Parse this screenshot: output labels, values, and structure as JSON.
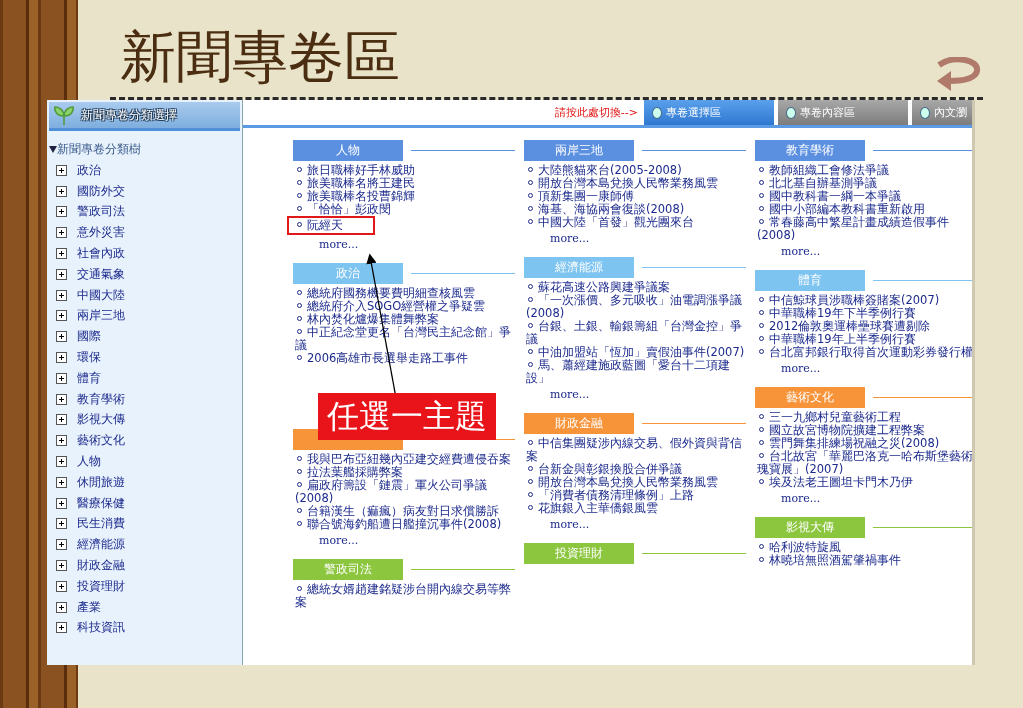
{
  "slide": {
    "title": "新聞專卷區"
  },
  "sidebar": {
    "header": "新聞專卷分類選擇",
    "tree": {
      "label": "新聞專卷分類樹",
      "expanded": true,
      "children": [
        {
          "label": "政治",
          "expanded": false
        },
        {
          "label": "國防外交",
          "expanded": false
        },
        {
          "label": "警政司法",
          "expanded": false
        },
        {
          "label": "意外災害",
          "expanded": false
        },
        {
          "label": "社會內政",
          "expanded": false
        },
        {
          "label": "交通氣象",
          "expanded": false
        },
        {
          "label": "中國大陸",
          "expanded": false
        },
        {
          "label": "兩岸三地",
          "expanded": false
        },
        {
          "label": "國際",
          "expanded": false
        },
        {
          "label": "環保",
          "expanded": false
        },
        {
          "label": "體育",
          "expanded": false
        },
        {
          "label": "教育學術",
          "expanded": false
        },
        {
          "label": "影視大傳",
          "expanded": false
        },
        {
          "label": "藝術文化",
          "expanded": false
        },
        {
          "label": "人物",
          "expanded": false
        },
        {
          "label": "休閒旅遊",
          "expanded": false
        },
        {
          "label": "醫療保健",
          "expanded": false
        },
        {
          "label": "民生消費",
          "expanded": false
        },
        {
          "label": "經濟能源",
          "expanded": false
        },
        {
          "label": "財政金融",
          "expanded": false
        },
        {
          "label": "投資理財",
          "expanded": false
        },
        {
          "label": "產業",
          "expanded": false
        },
        {
          "label": "科技資訊",
          "expanded": false
        }
      ]
    }
  },
  "toolbar": {
    "hint": "請按此處切換-->",
    "tabs": [
      {
        "label": "專卷選擇區",
        "selected": true
      },
      {
        "label": "專卷內容區",
        "selected": false
      },
      {
        "label": "內文瀏",
        "selected": false
      }
    ]
  },
  "columns": [
    {
      "sections": [
        {
          "title": "人物",
          "color": "#5b8fe0",
          "items": [
            {
              "text": "旅日職棒好手林威助",
              "highlighted": false
            },
            {
              "text": "旅美職棒名將王建民",
              "highlighted": false
            },
            {
              "text": "旅美職棒名投曹錦輝",
              "highlighted": false
            },
            {
              "text": "「恰恰」彭政閔",
              "highlighted": false
            },
            {
              "text": "阮經天",
              "highlighted": true
            }
          ],
          "more": "more..."
        },
        {
          "title": "政治",
          "color": "#7ec4f0",
          "items": [
            {
              "text": "總統府國務機要費明細查核風雲",
              "highlighted": false
            },
            {
              "text": "總統府介入SOGO經營權之爭疑雲",
              "highlighted": false
            },
            {
              "text": "林內焚化爐爆集體舞弊案",
              "highlighted": false
            },
            {
              "text": "中正紀念堂更名「台灣民主紀念館」爭議",
              "highlighted": false
            },
            {
              "text": "2006高雄市長選舉走路工事件",
              "highlighted": false
            }
          ]
        },
        {
          "color": "#f7943a",
          "items": [
            {
              "text": "我與巴布亞紐幾內亞建交經費遭侵吞案",
              "highlighted": false
            },
            {
              "text": "拉法葉艦採購弊案",
              "highlighted": false
            },
            {
              "text": "扁政府籌設「鏈震」軍火公司爭議(2008)",
              "highlighted": false
            },
            {
              "text": "台籍漢生（痲瘋）病友對日求償勝訴",
              "highlighted": false
            },
            {
              "text": "聯合號海釣船遭日艦撞沉事件(2008)",
              "highlighted": false
            }
          ],
          "more": "more..."
        },
        {
          "title": "警政司法",
          "color": "#8cc63f",
          "items": [
            {
              "text": "總統女婿趙建銘疑涉台開內線交易等弊案",
              "highlighted": false
            }
          ]
        }
      ]
    },
    {
      "sections": [
        {
          "title": "兩岸三地",
          "color": "#5b8fe0",
          "items": [
            {
              "text": "大陸熊貓來台(2005-2008)",
              "highlighted": false
            },
            {
              "text": "開放台灣本島兌換人民幣業務風雲",
              "highlighted": false
            },
            {
              "text": "頂新集團一康師傅",
              "highlighted": false
            },
            {
              "text": "海基、海協兩會復談(2008)",
              "highlighted": false
            },
            {
              "text": "中國大陸「首發」觀光團來台",
              "highlighted": false
            }
          ],
          "more": "more..."
        },
        {
          "title": "經濟能源",
          "color": "#7ec4f0",
          "items": [
            {
              "text": "蘇花高速公路興建爭議案",
              "highlighted": false
            },
            {
              "text": "「一次漲價、多元吸收」油電調漲爭議(2008)",
              "highlighted": false
            },
            {
              "text": "台銀、土銀、輸銀籌組「台灣金控」爭議",
              "highlighted": false
            },
            {
              "text": "中油加盟站「恆加」賣假油事件(2007)",
              "highlighted": false
            },
            {
              "text": "馬、蕭經建施政藍圖「愛台十二項建設」",
              "highlighted": false
            }
          ],
          "more": "more..."
        },
        {
          "title": "財政金融",
          "color": "#f7943a",
          "items": [
            {
              "text": "中信集團疑涉內線交易、假外資與背信案",
              "highlighted": false
            },
            {
              "text": "台新金與彰銀換股合併爭議",
              "highlighted": false
            },
            {
              "text": "開放台灣本島兌換人民幣業務風雲",
              "highlighted": false
            },
            {
              "text": "「消費者債務清理條例」上路",
              "highlighted": false
            },
            {
              "text": "花旗銀入主華僑銀風雲",
              "highlighted": false
            }
          ],
          "more": "more..."
        },
        {
          "title": "投資理財",
          "color": "#8cc63f"
        }
      ]
    },
    {
      "sections": [
        {
          "title": "教育學術",
          "color": "#5b8fe0",
          "items": [
            {
              "text": "教師組織工會修法爭議",
              "highlighted": false
            },
            {
              "text": "北北基自辦基測爭議",
              "highlighted": false
            },
            {
              "text": "國中教科書一綱一本爭議",
              "highlighted": false
            },
            {
              "text": "國中小部編本教科書重新啟用",
              "highlighted": false
            },
            {
              "text": "常春藤高中繁星計畫成績造假事件(2008)",
              "highlighted": false
            }
          ],
          "more": "more..."
        },
        {
          "title": "體育",
          "color": "#7ec4f0",
          "items": [
            {
              "text": "中信鯨球員涉職棒簽賭案(2007)",
              "highlighted": false
            },
            {
              "text": "中華職棒19年下半季例行賽",
              "highlighted": false
            },
            {
              "text": "2012倫敦奧運棒壘球賽遭剔除",
              "highlighted": false
            },
            {
              "text": "中華職棒19年上半季例行賽",
              "highlighted": false
            },
            {
              "text": "台北富邦銀行取得首次運動彩券發行權",
              "highlighted": false
            }
          ],
          "more": "more..."
        },
        {
          "title": "藝術文化",
          "color": "#f7943a",
          "items": [
            {
              "text": "三一九鄉村兒童藝術工程",
              "highlighted": false
            },
            {
              "text": "國立故宮博物院擴建工程弊案",
              "highlighted": false
            },
            {
              "text": "雲門舞集排練場祝融之災(2008)",
              "highlighted": false
            },
            {
              "text": "台北故宮「華麗巴洛克一哈布斯堡藝術瑰寶展」(2007)",
              "highlighted": false
            },
            {
              "text": "埃及法老王圖坦卡門木乃伊",
              "highlighted": false
            }
          ],
          "more": "more..."
        },
        {
          "title": "影視大傳",
          "color": "#8cc63f",
          "items": [
            {
              "text": "哈利波特旋風",
              "highlighted": false
            },
            {
              "text": "林曉培無照酒駕肇禍事件",
              "highlighted": false
            }
          ]
        }
      ]
    }
  ],
  "callout": {
    "text": "任選一主題"
  }
}
